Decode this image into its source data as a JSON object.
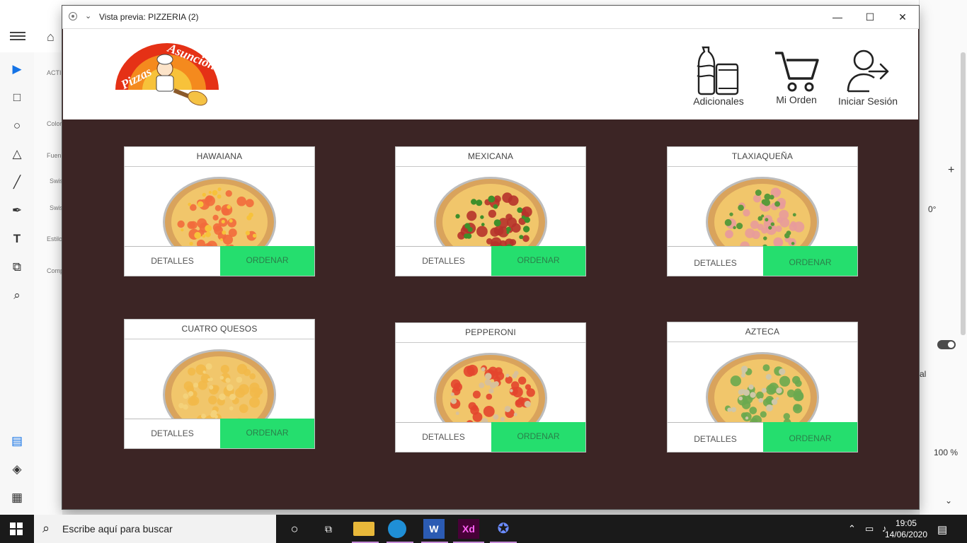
{
  "window": {
    "title": "Vista previa: PIZZERIA (2)",
    "minimize_icon": "minimize-icon",
    "maximize_icon": "maximize-icon",
    "close_icon": "close-icon"
  },
  "header": {
    "logo_text": "Pizzas Asunción",
    "nav": [
      {
        "label": "Adicionales",
        "icon": "drinks-icon"
      },
      {
        "label": "Mi Orden",
        "icon": "cart-icon"
      },
      {
        "label": "Iniciar Sesión",
        "icon": "login-icon"
      }
    ]
  },
  "pizzas": [
    {
      "name": "HAWAIANA",
      "details": "DETALLES",
      "order": "ORDENAR",
      "topping": "#f26a3c",
      "accent": "#f7c23a"
    },
    {
      "name": "MEXICANA",
      "details": "DETALLES",
      "order": "ORDENAR",
      "topping": "#b6322b",
      "accent": "#3f8f2a"
    },
    {
      "name": "TLAXIAQUEÑA",
      "details": "DETALLES",
      "order": "ORDENAR",
      "topping": "#e89b9b",
      "accent": "#5a9a3a"
    },
    {
      "name": "CUATRO QUESOS",
      "details": "DETALLES",
      "order": "ORDENAR",
      "topping": "#f2b94a",
      "accent": "#f4d27a"
    },
    {
      "name": "PEPPERONI",
      "details": "DETALLES",
      "order": "ORDENAR",
      "topping": "#e3452e",
      "accent": "#d8c09a"
    },
    {
      "name": "AZTECA",
      "details": "DETALLES",
      "order": "ORDENAR",
      "topping": "#6aa84f",
      "accent": "#cfc7a8"
    }
  ],
  "colors": {
    "content_bg": "#3c2525",
    "order_button": "#25de6e"
  },
  "xd_background": {
    "assets_labels": [
      "ACTI",
      "Color",
      "Fuen",
      "Swis",
      "Swis",
      "Estilo",
      "Comp"
    ],
    "right_labels": {
      "angle": "0°",
      "zoom": "100 %",
      "percent": "%",
      "al": "al"
    }
  },
  "taskbar": {
    "search_placeholder": "Escribe aquí para buscar",
    "time": "19:05",
    "date": "14/06/2020"
  }
}
